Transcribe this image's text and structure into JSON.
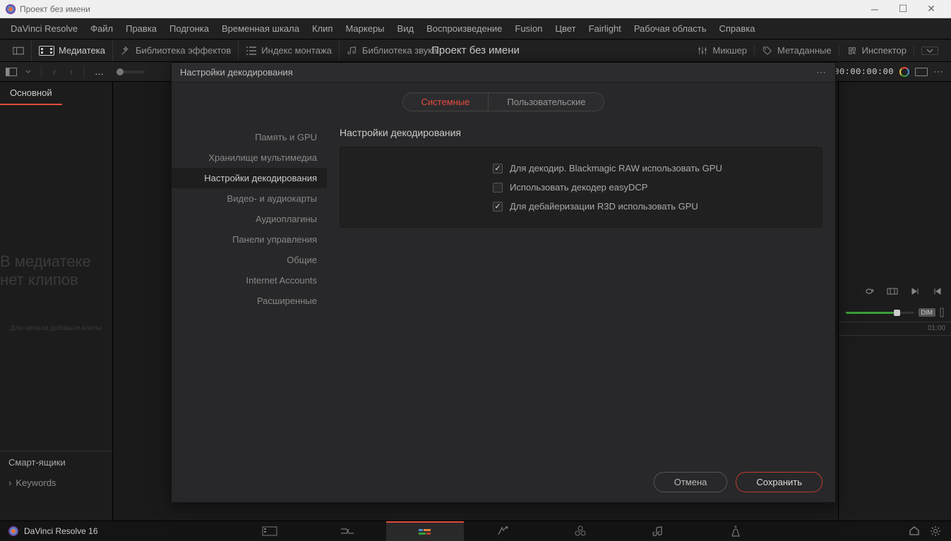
{
  "window": {
    "title": "Проект без имени"
  },
  "menubar": [
    "DaVinci Resolve",
    "Файл",
    "Правка",
    "Подгонка",
    "Временная шкала",
    "Клип",
    "Маркеры",
    "Вид",
    "Воспроизведение",
    "Fusion",
    "Цвет",
    "Fairlight",
    "Рабочая область",
    "Справка"
  ],
  "toolbar": {
    "mediapool": "Медиатека",
    "effects": "Библиотека эффектов",
    "editindex": "Индекс монтажа",
    "soundlib": "Библиотека звука",
    "mixer": "Микшер",
    "metadata": "Метаданные",
    "inspector": "Инспектор"
  },
  "project_title": "Проект без имени",
  "secbar": {
    "breadcrumb": "…",
    "timecode": "00:00:00:00"
  },
  "sidebar": {
    "tab": "Основной",
    "placeholder": "В медиатеке нет клипов",
    "hint": "Для начала добавьте клипы",
    "smartbins": "Смарт-ящики",
    "keywords": "Keywords"
  },
  "right": {
    "dim": "DIM",
    "time_end": "01:00"
  },
  "modal": {
    "title": "Настройки декодирования",
    "tabs": {
      "system": "Системные",
      "user": "Пользовательские"
    },
    "nav": [
      "Память и GPU",
      "Хранилище мультимедиа",
      "Настройки декодирования",
      "Видео- и аудиокарты",
      "Аудиоплагины",
      "Панели управления",
      "Общие",
      "Internet Accounts",
      "Расширенные"
    ],
    "nav_active_index": 2,
    "section_title": "Настройки декодирования",
    "checks": [
      {
        "label": "Для декодир. Blackmagic RAW использовать GPU",
        "checked": true
      },
      {
        "label": "Использовать декодер easyDCP",
        "checked": false
      },
      {
        "label": "Для дебайеризации R3D использовать GPU",
        "checked": true
      }
    ],
    "cancel": "Отмена",
    "save": "Сохранить"
  },
  "bottom": {
    "brand": "DaVinci Resolve 16"
  }
}
